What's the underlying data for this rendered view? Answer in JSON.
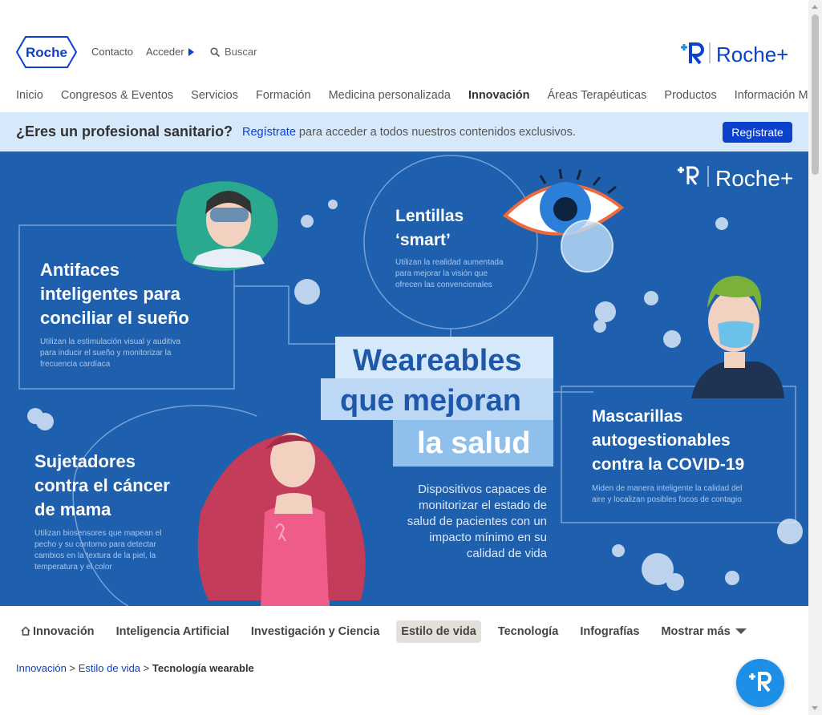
{
  "header": {
    "logo_text": "Roche",
    "contact": "Contacto",
    "login": "Acceder",
    "search_placeholder": "Buscar",
    "brand": "Roche+"
  },
  "nav": [
    "Inicio",
    "Congresos & Eventos",
    "Servicios",
    "Formación",
    "Medicina personalizada",
    "Innovación",
    "Áreas Terapéuticas",
    "Productos",
    "Información Médica"
  ],
  "nav_active": "Innovación",
  "banner": {
    "question": "¿Eres un profesional sanitario?",
    "link": "Regístrate",
    "text": " para acceder a todos nuestros contenidos exclusivos.",
    "button": "Regístrate"
  },
  "hero": {
    "brand": "Roche+",
    "title": [
      "Weareables",
      "que mejoran",
      "la salud"
    ],
    "description": [
      "Dispositivos capaces de",
      "monitorizar el estado de",
      "salud de pacientes con un",
      "impacto mínimo en su",
      "calidad de vida"
    ],
    "items": {
      "lentillas": {
        "title": [
          "Lentillas",
          "‘smart’"
        ],
        "text": [
          "Utilizan la realidad aumentada",
          "para mejorar la visión que",
          "ofrecen las convencionales"
        ]
      },
      "antifaces": {
        "title": [
          "Antifaces",
          "inteligentes para",
          "conciliar el sueño"
        ],
        "text": [
          "Utilizan la estimulación visual y auditiva",
          "para inducir el sueño y monitorizar la",
          "frecuencia cardíaca"
        ]
      },
      "mascarillas": {
        "title": [
          "Mascarillas",
          "autogestionables",
          "contra la COVID-19"
        ],
        "text": [
          "Miden de manera inteligente la calidad del",
          "aire y localizan posibles focos de contagio"
        ]
      },
      "sujetadores": {
        "title": [
          "Sujetadores",
          "contra el cáncer",
          "de mama"
        ],
        "text": [
          "Utilizan biosensores que mapean el",
          "pecho y su contorno para detectar",
          "cambios en la textura de la piel, la",
          "temperatura y el color"
        ]
      }
    }
  },
  "subnav": {
    "items": [
      "Innovación",
      "Inteligencia Artificial",
      "Investigación y Ciencia",
      "Estilo de vida",
      "Tecnología",
      "Infografías"
    ],
    "selected": "Estilo de vida",
    "more": "Mostrar más"
  },
  "breadcrumb": {
    "items": [
      "Innovación",
      "Estilo de vida"
    ],
    "current": "Tecnología wearable"
  },
  "colors": {
    "brand_blue": "#0b41cd",
    "hero_bg": "#1e5fae",
    "banner_bg": "#d6e9fb",
    "fab": "#1e8fe6"
  }
}
